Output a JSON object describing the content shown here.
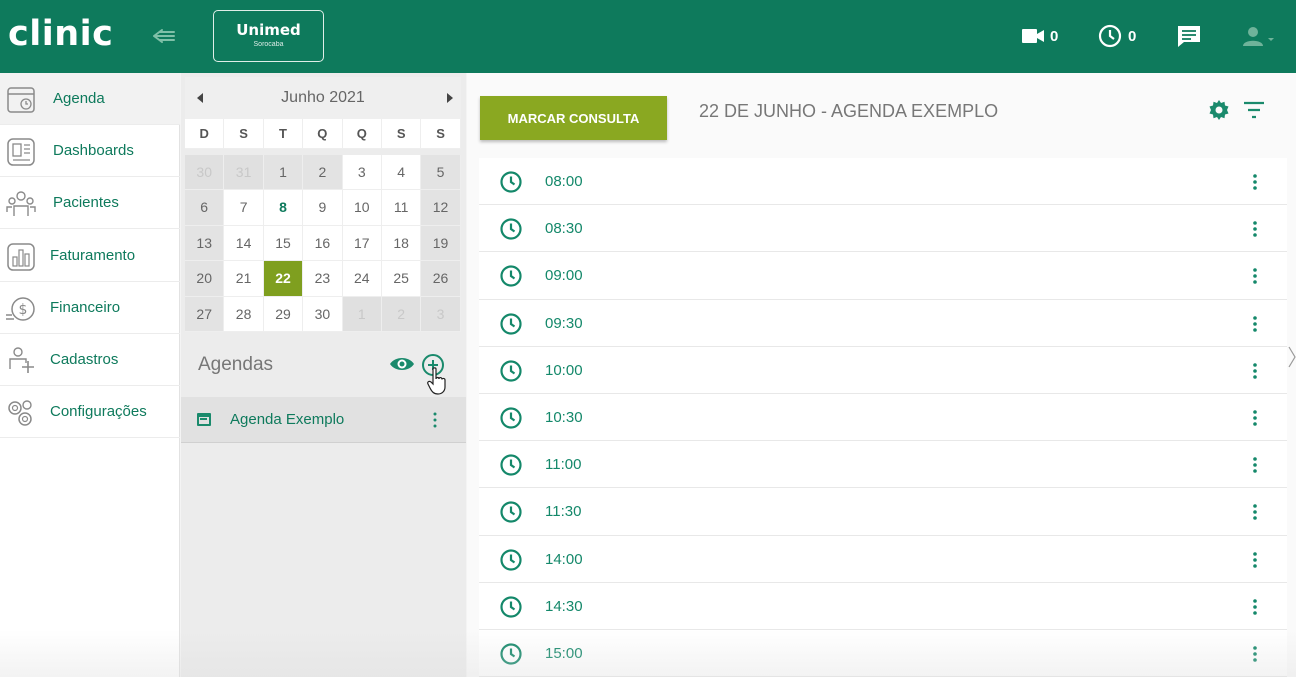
{
  "header": {
    "brand": "clinic",
    "partner_name": "Unimed",
    "partner_city": "Sorocaba",
    "video_count": "0",
    "clock_count": "0",
    "icons": [
      "back-arrow-icon",
      "video-camera-icon",
      "clock-icon",
      "chat-icon",
      "user-icon",
      "chevron-down-icon"
    ]
  },
  "sidebar": {
    "items": [
      {
        "label": "Agenda",
        "icon": "calendar-icon",
        "active": true
      },
      {
        "label": "Dashboards",
        "icon": "dashboard-icon"
      },
      {
        "label": "Pacientes",
        "icon": "patients-icon"
      },
      {
        "label": "Faturamento",
        "icon": "billing-chart-icon"
      },
      {
        "label": "Financeiro",
        "icon": "money-icon"
      },
      {
        "label": "Cadastros",
        "icon": "registry-icon"
      },
      {
        "label": "Configurações",
        "icon": "settings-icon"
      }
    ]
  },
  "calendar": {
    "month_label": "Junho  2021",
    "weekdays": [
      "D",
      "S",
      "T",
      "Q",
      "Q",
      "S",
      "S"
    ],
    "weeks": [
      [
        "30",
        "31",
        "1",
        "2",
        "3",
        "4",
        "5"
      ],
      [
        "6",
        "7",
        "8",
        "9",
        "10",
        "11",
        "12"
      ],
      [
        "13",
        "14",
        "15",
        "16",
        "17",
        "18",
        "19"
      ],
      [
        "20",
        "21",
        "22",
        "23",
        "24",
        "25",
        "26"
      ],
      [
        "27",
        "28",
        "29",
        "30",
        "1",
        "2",
        "3"
      ]
    ],
    "today": "8",
    "selected": "22"
  },
  "agendas": {
    "title": "Agendas",
    "items": [
      {
        "label": "Agenda Exemplo"
      }
    ]
  },
  "main": {
    "button_label": "MARCAR CONSULTA",
    "title": "22 DE JUNHO - AGENDA EXEMPLO",
    "slots": [
      "08:00",
      "08:30",
      "09:00",
      "09:30",
      "10:00",
      "10:30",
      "11:00",
      "11:30",
      "14:00",
      "14:30",
      "15:00"
    ]
  },
  "colors": {
    "primary_green": "#0e7a5c",
    "accent_olive": "#8aa821"
  }
}
